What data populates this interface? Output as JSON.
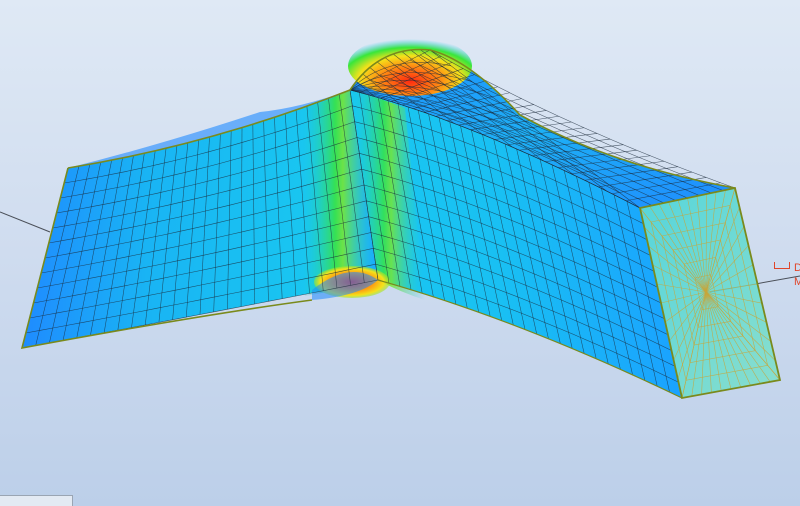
{
  "viewport": {
    "view": "3D results map",
    "colormap": [
      "#2b3cff",
      "#1f8bff",
      "#19c8f0",
      "#1fe6a0",
      "#39e63a",
      "#b8f01e",
      "#f4e21a",
      "#ff8a12",
      "#ff2a10"
    ],
    "background": [
      "#dfe9f5",
      "#bccfe9"
    ],
    "mesh_color": "#1b2a3a",
    "outline_color": "#7a8a1c",
    "section_color": "#c8a63a",
    "marker_color": "#e0462a"
  },
  "edge_marker": {
    "glyph_top": "D",
    "glyph_bottom": "M"
  }
}
